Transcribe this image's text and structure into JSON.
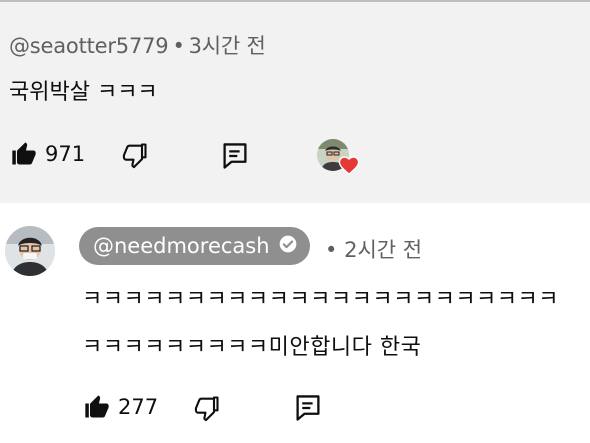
{
  "comment": {
    "handle": "@seaotter5779",
    "separator": "•",
    "time": "3시간 전",
    "text": "국위박살 ㅋㅋㅋ",
    "likes": "971"
  },
  "reply": {
    "handle": "@needmorecash",
    "separator": "•",
    "time": "2시간 전",
    "text_line1": "ㅋㅋㅋㅋㅋㅋㅋㅋㅋㅋㅋㅋㅋㅋㅋㅋㅋㅋㅋㅋㅋㅋㅋ",
    "text_line2": "ㅋㅋㅋㅋㅋㅋㅋㅋㅋ미안합니다 한국",
    "likes": "277"
  },
  "icons": {
    "like": "thumbs-up-icon",
    "dislike": "thumbs-down-icon",
    "reply": "reply-comment-icon",
    "verified": "verified-check-icon",
    "creator_heart": "heart-icon"
  },
  "colors": {
    "top_comment_bg": "#f2f2f2",
    "handle_pill_bg": "#8f8f8f",
    "meta_text": "#606060",
    "heart": "#e53935"
  }
}
